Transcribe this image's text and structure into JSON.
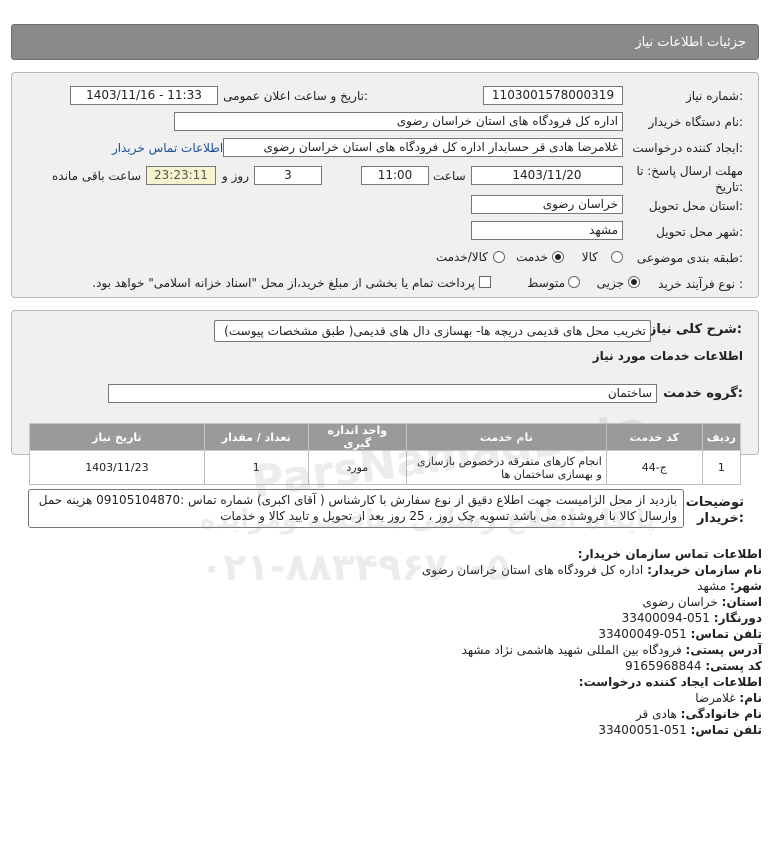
{
  "header": {
    "title": "جزئیات اطلاعات نیاز"
  },
  "form": {
    "need_number_label": "شماره نیاز:",
    "need_number": "1103001578000319",
    "announce_label": "تاریخ و ساعت اعلان عمومی:",
    "announce_value": "1403/11/16 - 11:33",
    "buyer_org_label": "نام دستگاه خریدار:",
    "buyer_org": "اداره کل فرودگاه های استان خراسان رضوی",
    "creator_label": "ایجاد کننده درخواست:",
    "creator": "غلامرضا هادی قر حسابدار اداره کل فرودگاه های استان خراسان رضوی",
    "contact_link": "اطلاعات تماس خریدار",
    "deadline_label_1": "مهلت ارسال پاسخ: تا",
    "deadline_label_2": "تاریخ:",
    "deadline_date": "1403/11/20",
    "time_label": "ساعت",
    "deadline_time": "11:00",
    "days": "3",
    "day_and_label": "روز و",
    "remaining": "23:23:11",
    "remaining_label": "ساعت باقی مانده",
    "province_label": "استان محل تحویل:",
    "province": "خراسان رضوی",
    "city_label": "شهر محل تحویل:",
    "city": "مشهد",
    "category_label": "طبقه بندی موضوعی:",
    "cat_goods": "کالا",
    "cat_service": "خدمت",
    "cat_goods_service": "کالا/خدمت",
    "process_label": "نوع فرآیند خرید :",
    "proc_partial": "جزیی",
    "proc_medium": "متوسط",
    "payment_note": "پرداخت تمام یا بخشی از مبلغ خرید،از محل \"اسناد خزانه اسلامی\" خواهد بود."
  },
  "description": {
    "label": "شرح کلی نیاز:",
    "value": "تخریب محل های قدیمی دریچه ها- بهسازی دال های قدیمی( طبق مشخصات پیوست)",
    "services_heading": "اطلاعات خدمات مورد نیاز",
    "service_group_label": "گروه خدمت:",
    "service_group": "ساختمان"
  },
  "table": {
    "headers": [
      "ردیف",
      "کد خدمت",
      "نام خدمت",
      "واحد اندازه گیری",
      "تعداد / مقدار",
      "تاریخ نیاز"
    ],
    "rows": [
      [
        "1",
        "ج-44",
        "انجام کارهای متفرقه درخصوص بازسازی و بهسازی ساختمان ها",
        "مورد",
        "1",
        "1403/11/23"
      ]
    ]
  },
  "buyer_notes": {
    "label_1": "توضیحات",
    "label_2": "خریدار:",
    "line_1": "بازدید از محل الزامیست جهت اطلاع دقیق از نوع سفارش با کارشناس ( آقای اکبری) شماره تماس :09105104870 هزینه حمل",
    "line_2": "وارسال کالا با فروشنده می باشد تسویه چک روز ، 25 روز بعد از تحویل و تایید کالا و خدمات"
  },
  "contact": {
    "org_heading": "اطلاعات تماس سازمان خریدار:",
    "org_name_label": "نام سازمان خریدار:",
    "org_name": "اداره کل فرودگاه های استان خراسان رضوی",
    "city_label": "شهر:",
    "city": "مشهد",
    "province_label": "استان:",
    "province": "خراسان رضوی",
    "fax_label": "دورنگار:",
    "fax": "051-33400094",
    "phone_label": "تلفن تماس:",
    "phone": "051-33400049",
    "address_label": "آدرس پستی:",
    "address": "فرودگاه بین المللی شهید هاشمی نژاد مشهد",
    "postal_label": "کد پستی:",
    "postal": "9165968844",
    "creator_heading": "اطلاعات ایجاد کننده درخواست:",
    "first_name_label": "نام:",
    "first_name": "غلامرضا",
    "last_name_label": "نام خانوادگی:",
    "last_name": "هادی قر",
    "creator_phone_label": "تلفن تماس:",
    "creator_phone": "051-33400051"
  },
  "watermark": {
    "brand": "ParsNamadData",
    "tagline": "پایگاه اطلاع رسانی مناقصه ومزایده",
    "phone": "۰۲۱-۸۸۳۴۹۶۷۰-۵"
  }
}
